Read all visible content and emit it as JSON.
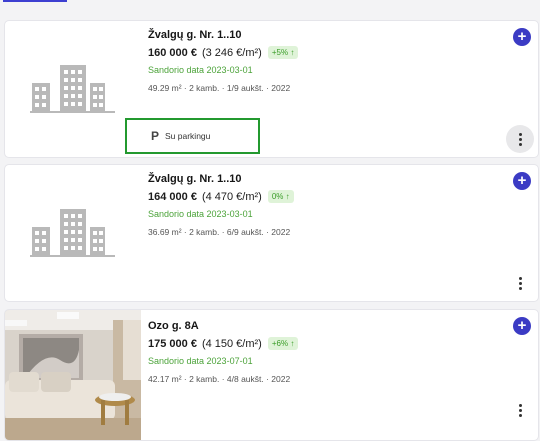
{
  "listings": [
    {
      "address": "Žvalgų g. Nr. 1..10",
      "price": "160 000 €",
      "price_per_m2": "(3 246 €/m²)",
      "change_badge": "+5% ↑",
      "deal_date": "Sandorio data 2023-03-01",
      "meta": "49.29 m² · 2 kamb. · 1/9 aukšt. · 2022",
      "parking_label": "Su parkingu",
      "parking_icon": "P",
      "image": "building-placeholder-icon"
    },
    {
      "address": "Žvalgų g. Nr. 1..10",
      "price": "164 000 €",
      "price_per_m2": "(4 470 €/m²)",
      "change_badge": "0% ↑",
      "deal_date": "Sandorio data 2023-03-01",
      "meta": "36.69 m² · 2 kamb. · 6/9 aukšt. · 2022",
      "image": "building-placeholder-icon"
    },
    {
      "address": "Ozo g. 8A",
      "price": "175 000 €",
      "price_per_m2": "(4 150 €/m²)",
      "change_badge": "+6% ↑",
      "deal_date": "Sandorio data 2023-07-01",
      "meta": "42.17 m² · 2 kamb. · 4/8 aukšt. · 2022",
      "image": "living-room-photo"
    }
  ],
  "actions": {
    "add": "+",
    "more": "more-vert-icon"
  },
  "colors": {
    "accent": "#3b3bc4",
    "green": "#4ca33a",
    "badge_bg": "#dff3d8",
    "highlight": "#23992f"
  }
}
